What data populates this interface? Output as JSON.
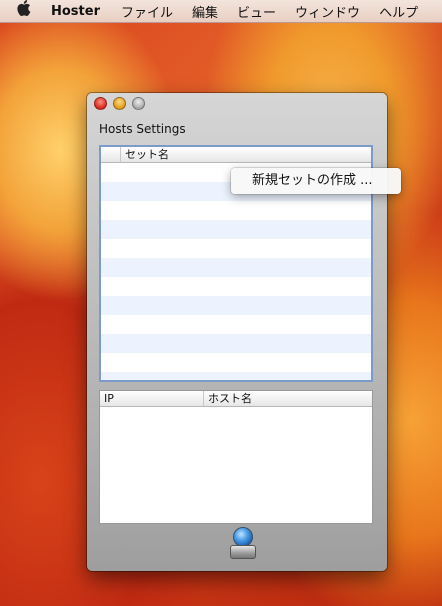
{
  "menubar": {
    "app_name": "Hoster",
    "items": [
      "ファイル",
      "編集",
      "ビュー",
      "ウィンドウ",
      "ヘルプ"
    ]
  },
  "window": {
    "title": "Hosts Settings"
  },
  "sets_table": {
    "columns": [
      "",
      "セット名"
    ],
    "rows": []
  },
  "hosts_table": {
    "columns": [
      "IP",
      "ホスト名"
    ],
    "rows": []
  },
  "context_menu": {
    "items": [
      "新規セットの作成 ..."
    ]
  },
  "toolbar": {
    "icon": "network-globe-icon"
  },
  "colors": {
    "selection_border": "#7d9bc9",
    "alt_row": "#edf3fe"
  }
}
